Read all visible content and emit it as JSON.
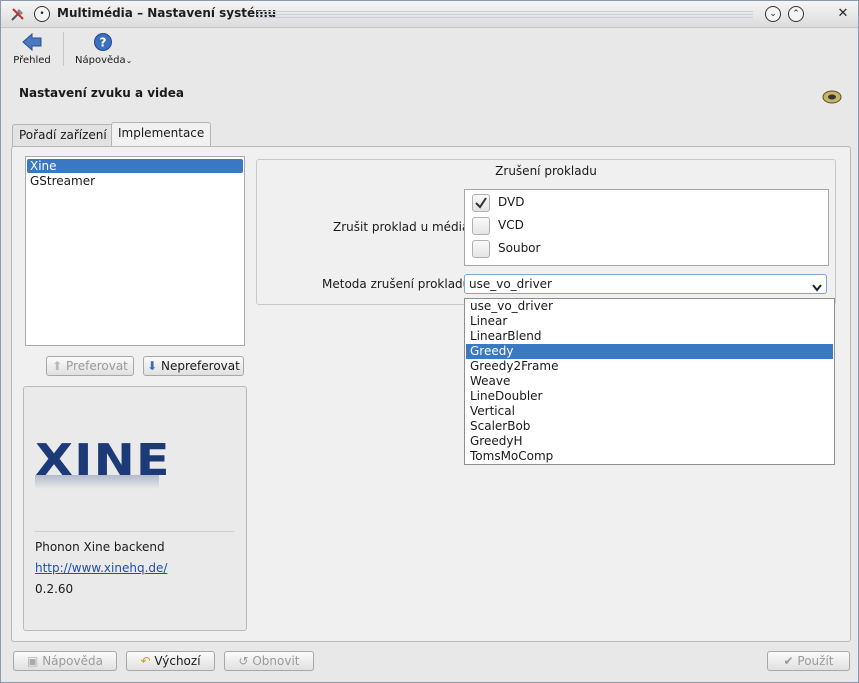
{
  "window": {
    "title": "Multimédia – Nastavení systému"
  },
  "toolbar": {
    "back_label": "Přehled",
    "help_label": "Nápověda"
  },
  "page": {
    "heading": "Nastavení zvuku a videa"
  },
  "tabs": [
    {
      "label": "Pořadí zařízení",
      "active": false
    },
    {
      "label": "Implementace",
      "active": true
    }
  ],
  "backends": {
    "items": [
      "Xine",
      "GStreamer"
    ],
    "selected": "Xine"
  },
  "backend_buttons": {
    "prefer": "Preferovat",
    "unprefer": "Nepreferovat"
  },
  "backend_info": {
    "logo_text": "XINE",
    "name": "Phonon Xine backend",
    "url": "http://www.xinehq.de/",
    "version": "0.2.60"
  },
  "deinterlace": {
    "group_title": "Zrušení prokladu",
    "media_label": "Zrušit proklad u média:",
    "media": [
      {
        "label": "DVD",
        "checked": true
      },
      {
        "label": "VCD",
        "checked": false
      },
      {
        "label": "Soubor",
        "checked": false
      }
    ],
    "method_label": "Metoda zrušení prokladu:",
    "method_value": "use_vo_driver",
    "method_options": [
      "use_vo_driver",
      "Linear",
      "LinearBlend",
      "Greedy",
      "Greedy2Frame",
      "Weave",
      "LineDoubler",
      "Vertical",
      "ScalerBob",
      "GreedyH",
      "TomsMoComp"
    ],
    "highlighted_option": "Greedy"
  },
  "footer": {
    "help": "Nápověda",
    "defaults": "Výchozí",
    "reset": "Obnovit",
    "apply": "Použít"
  },
  "colors": {
    "selection": "#3b78c4",
    "link": "#1f4fa8",
    "logo": "#1d3a78"
  }
}
